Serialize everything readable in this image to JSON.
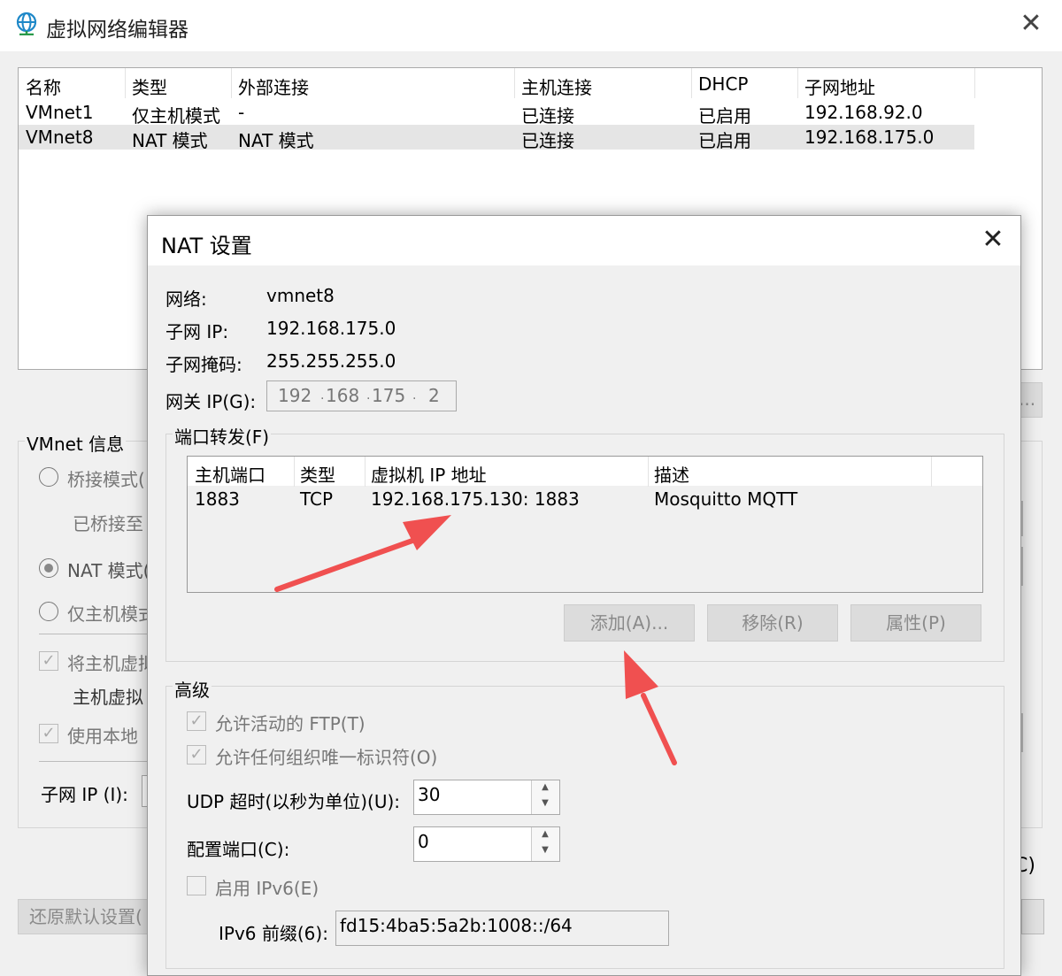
{
  "window": {
    "title": "虚拟网络编辑器",
    "close": "✕"
  },
  "network_table": {
    "headers": [
      "名称",
      "类型",
      "外部连接",
      "主机连接",
      "DHCP",
      "子网地址"
    ],
    "rows": [
      [
        "VMnet1",
        "仅主机模式",
        "-",
        "已连接",
        "已启用",
        "192.168.92.0"
      ],
      [
        "VMnet8",
        "NAT 模式",
        "NAT 模式",
        "已连接",
        "已启用",
        "192.168.175.0"
      ]
    ]
  },
  "vmnet_info": {
    "group_label": "VMnet 信息",
    "bridged": "桥接模式(",
    "bridged_to": "已桥接至",
    "nat": "NAT 模式(",
    "host_only": "仅主机模式",
    "connect_host": "将主机虚拟",
    "host_adapter": "主机虚拟",
    "use_local": "使用本地",
    "subnet_ip": "子网 IP (I):",
    "restore_button": "还原默认设置(",
    "add_fragment": "...",
    "c_fragment": "C)"
  },
  "nat_dialog": {
    "title": "NAT 设置",
    "close": "✕",
    "network_label": "网络:",
    "network_value": "vmnet8",
    "subnet_ip_label": "子网 IP:",
    "subnet_ip_value": "192.168.175.0",
    "subnet_mask_label": "子网掩码:",
    "subnet_mask_value": "255.255.255.0",
    "gateway_label": "网关 IP(G):",
    "gateway_octets": [
      "192",
      "168",
      "175",
      "2"
    ],
    "port_forward_group": "端口转发(F)",
    "pf_headers": [
      "主机端口",
      "类型",
      "虚拟机 IP 地址",
      "描述"
    ],
    "pf_rows": [
      [
        "1883",
        "TCP",
        "192.168.175.130: 1883",
        "Mosquitto MQTT"
      ]
    ],
    "add_button": "添加(A)...",
    "remove_button": "移除(R)",
    "properties_button": "属性(P)",
    "advanced_group": "高级",
    "allow_ftp": "允许活动的 FTP(T)",
    "allow_oui": "允许任何组织唯一标识符(O)",
    "udp_timeout_label": "UDP 超时(以秒为单位)(U):",
    "udp_timeout_value": "30",
    "config_port_label": "配置端口(C):",
    "config_port_value": "0",
    "enable_ipv6": "启用 IPv6(E)",
    "ipv6_prefix_label": "IPv6 前缀(6):",
    "ipv6_prefix_value": "fd15:4ba5:5a2b:1008::/64"
  },
  "annotation_color": "#f05050"
}
